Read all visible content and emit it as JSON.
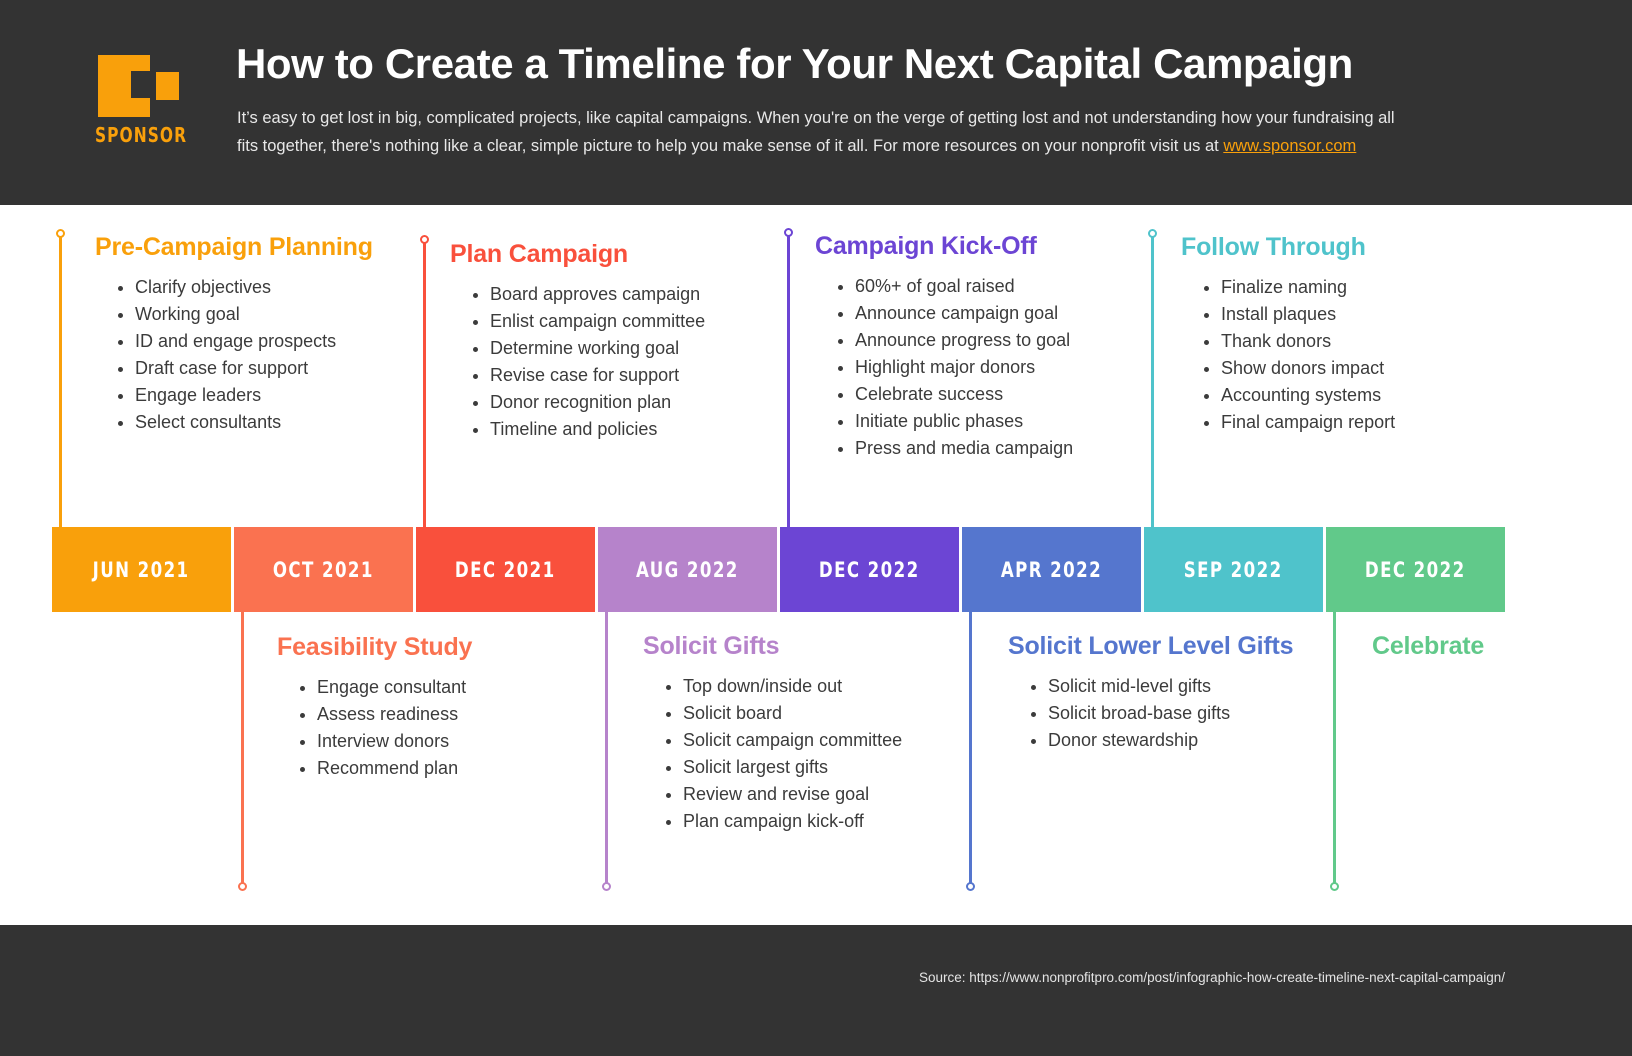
{
  "header": {
    "logo": {
      "icon": "sponsor-logo-icon",
      "wordmark": "SPONSOR",
      "color": "#F9A00B"
    },
    "title": "How to Create a Timeline for Your Next Capital Campaign",
    "subtitle_part1": "It’s easy to get lost in big, complicated projects, like capital campaigns. When you're on the verge of getting lost and not understanding how your fundraising all fits together, there's nothing like a clear, simple picture to help you make sense of it all. For more resources on your nonprofit visit us at ",
    "subtitle_link": "www.sponsor.com"
  },
  "timeline": {
    "dates": [
      {
        "label": "JUN 2021",
        "color": "#F9A00B"
      },
      {
        "label": "OCT 2021",
        "color": "#FA7250"
      },
      {
        "label": "DEC 2021",
        "color": "#F9503C"
      },
      {
        "label": "AUG 2022",
        "color": "#B683CB"
      },
      {
        "label": "DEC 2022",
        "color": "#6C45D4"
      },
      {
        "label": "APR 2022",
        "color": "#5576CE"
      },
      {
        "label": "SEP 2022",
        "color": "#4FC3CB"
      },
      {
        "label": "DEC 2022",
        "color": "#61C98A"
      }
    ]
  },
  "sections_top": [
    {
      "title": "Pre-Campaign Planning",
      "color": "#F9A00B",
      "items": [
        "Clarify objectives",
        "Working goal",
        "ID and engage prospects",
        "Draft case for support",
        "Engage leaders",
        "Select consultants"
      ]
    },
    {
      "title": "Plan Campaign",
      "color": "#F9503C",
      "items": [
        "Board approves campaign",
        "Enlist campaign committee",
        "Determine working goal",
        "Revise case for support",
        "Donor recognition plan",
        "Timeline and policies"
      ]
    },
    {
      "title": "Campaign Kick-Off",
      "color": "#6C45D4",
      "items": [
        "60%+ of goal raised",
        "Announce campaign goal",
        "Announce progress to goal",
        "Highlight major donors",
        "Celebrate success",
        "Initiate public phases",
        "Press and media campaign"
      ]
    },
    {
      "title": "Follow Through",
      "color": "#4FC3CB",
      "items": [
        "Finalize naming",
        "Install plaques",
        "Thank donors",
        "Show donors impact",
        "Accounting systems",
        "Final campaign report"
      ]
    }
  ],
  "sections_bottom": [
    {
      "title": "Feasibility Study",
      "color": "#FA7250",
      "items": [
        "Engage consultant",
        "Assess readiness",
        "Interview donors",
        "Recommend plan"
      ]
    },
    {
      "title": "Solicit Gifts",
      "color": "#B683CB",
      "items": [
        "Top down/inside out",
        "Solicit board",
        "Solicit campaign committee",
        "Solicit largest gifts",
        "Review and revise goal",
        "Plan campaign kick-off"
      ]
    },
    {
      "title": "Solicit Lower Level Gifts",
      "color": "#5576CE",
      "items": [
        "Solicit mid-level gifts",
        "Solicit broad-base gifts",
        "Donor stewardship"
      ]
    },
    {
      "title": "Celebrate",
      "color": "#61C98A",
      "items": []
    }
  ],
  "footer": {
    "source": "Source: https://www.nonprofitpro.com/post/infographic-how-create-timeline-next-capital-campaign/"
  }
}
